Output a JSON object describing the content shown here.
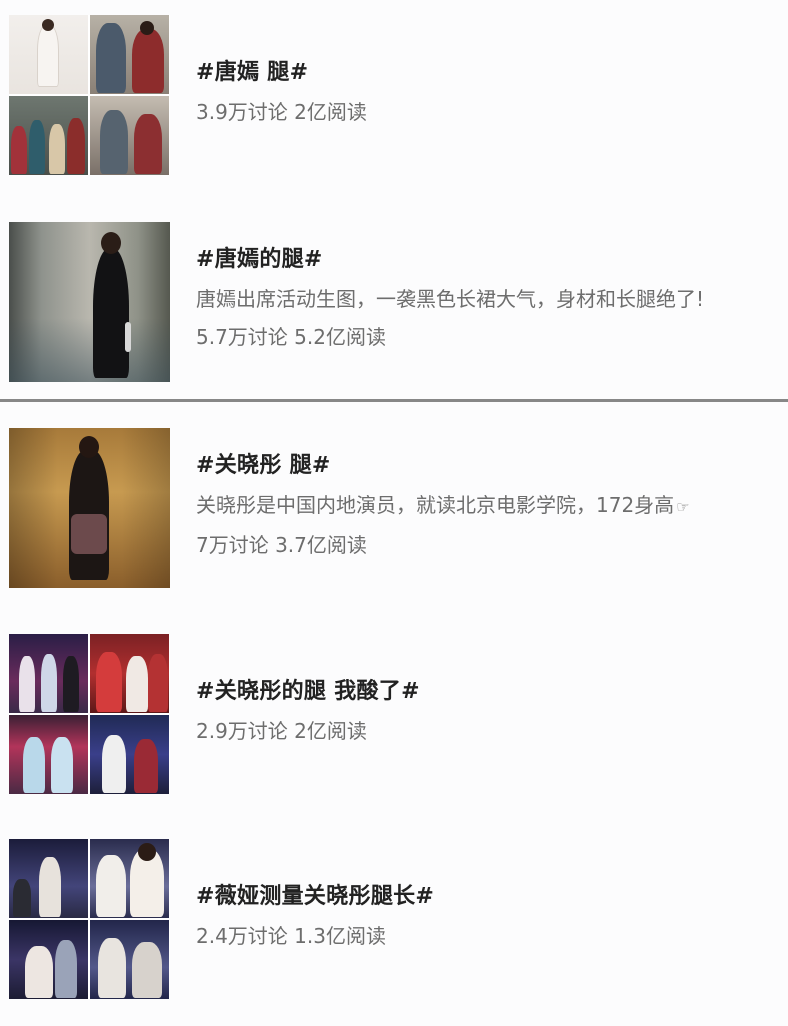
{
  "items": [
    {
      "title": "#唐嫣 腿#",
      "stats": "3.9万讨论 2亿阅读"
    },
    {
      "title": "#唐嫣的腿#",
      "desc": "唐嫣出席活动生图，一袭黑色长裙大气，身材和长腿绝了!",
      "stats": "5.7万讨论 5.2亿阅读"
    },
    {
      "title": "#关晓彤 腿#",
      "desc": "关晓彤是中国内地演员，就读北京电影学院，172身高",
      "stats": "7万讨论 3.7亿阅读"
    },
    {
      "title": "#关晓彤的腿 我酸了#",
      "stats": "2.9万讨论 2亿阅读"
    },
    {
      "title": "#薇娅测量关晓彤腿长#",
      "stats": "2.4万讨论 1.3亿阅读"
    }
  ],
  "icons": {
    "more_pointer": "pointing-hand-icon"
  }
}
